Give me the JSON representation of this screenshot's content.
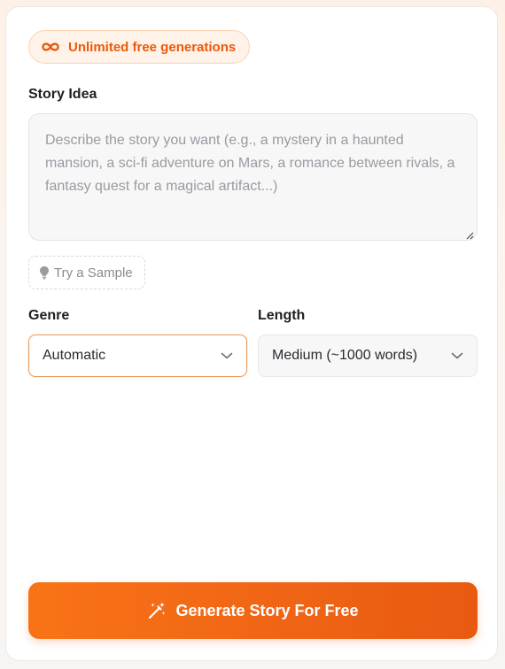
{
  "badge": {
    "icon": "infinity-icon",
    "label": "Unlimited free generations",
    "color": "#ea5a0c"
  },
  "story": {
    "label": "Story Idea",
    "placeholder": "Describe the story you want (e.g., a mystery in a haunted mansion, a sci-fi adventure on Mars, a romance between rivals, a fantasy quest for a magical artifact...)",
    "value": ""
  },
  "sample": {
    "icon": "lightbulb-icon",
    "label": "Try a Sample"
  },
  "genre": {
    "label": "Genre",
    "selected": "Automatic",
    "icon": "chevron-down-icon"
  },
  "length": {
    "label": "Length",
    "selected": "Medium (~1000 words)",
    "icon": "chevron-down-icon"
  },
  "generate": {
    "icon": "magic-wand-icon",
    "label": "Generate Story For Free",
    "color": "#f97316"
  }
}
